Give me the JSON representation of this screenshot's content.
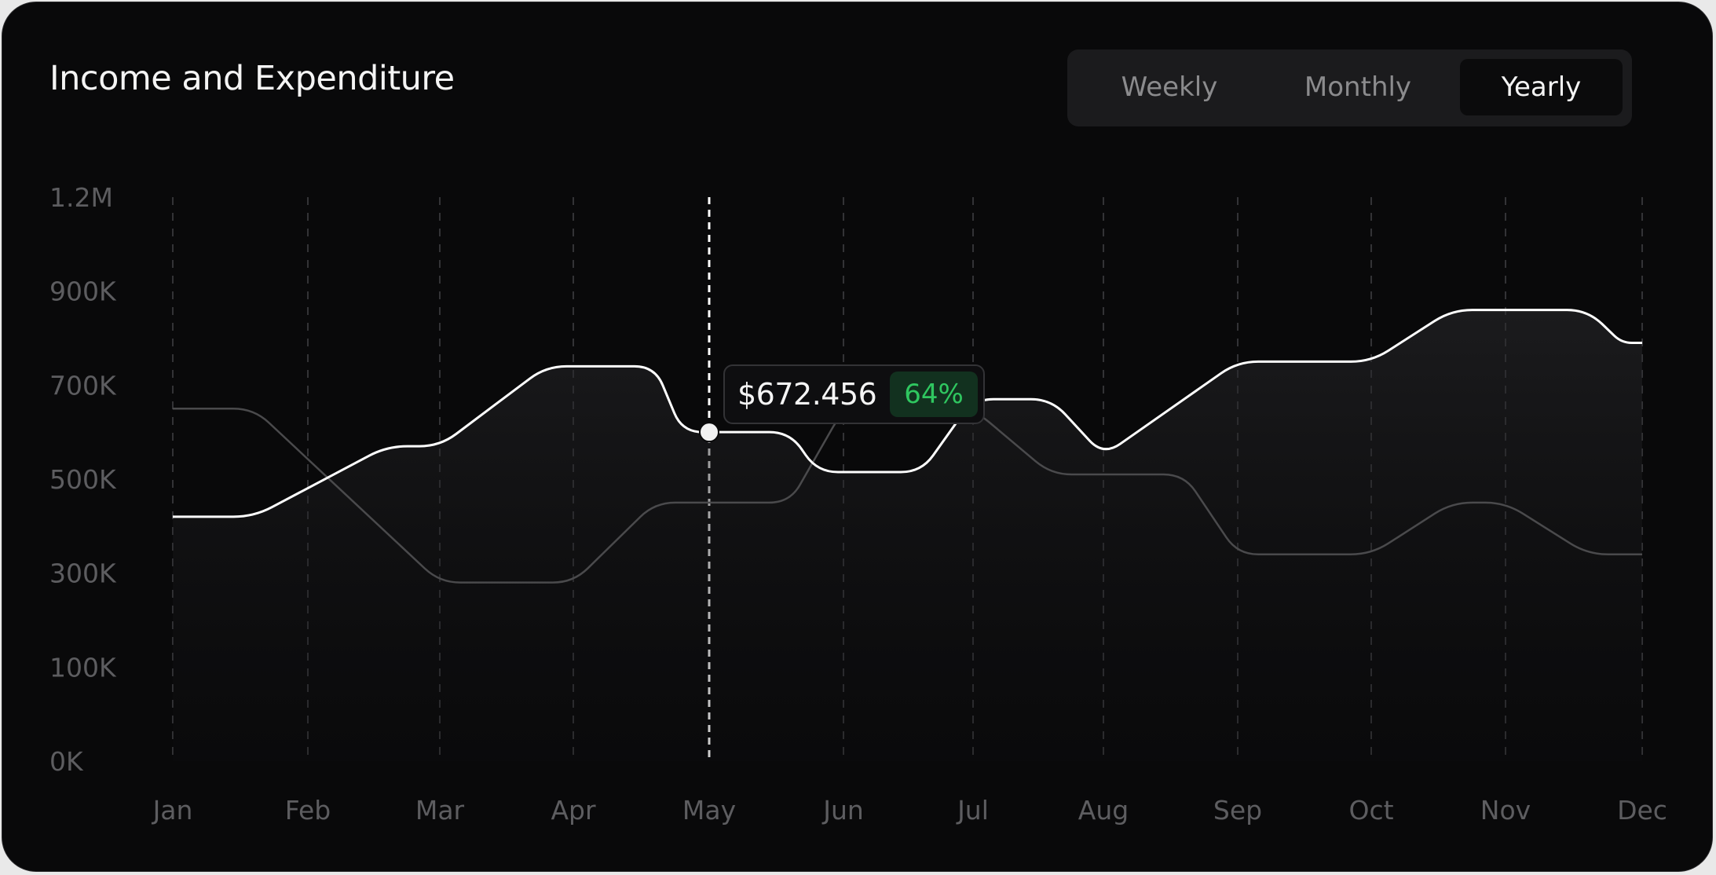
{
  "header": {
    "title": "Income and Expenditure"
  },
  "period_tabs": [
    {
      "label": "Weekly",
      "active": false
    },
    {
      "label": "Monthly",
      "active": false
    },
    {
      "label": "Yearly",
      "active": true
    }
  ],
  "tooltip": {
    "value": "$672.456",
    "badge": "64%",
    "badge_color": "#2fc760",
    "month": "May"
  },
  "colors": {
    "background": "#09090a",
    "primary_line": "#ffffff",
    "secondary_line": "#4a4a4c",
    "grid": "#333336",
    "axis_text": "#5d5d60"
  },
  "chart_data": {
    "type": "line",
    "title": "Income and Expenditure",
    "categories": [
      "Jan",
      "Feb",
      "Mar",
      "Apr",
      "May",
      "Jun",
      "Jul",
      "Aug",
      "Sep",
      "Oct",
      "Nov",
      "Dec"
    ],
    "y_tick_labels": [
      "0K",
      "100K",
      "300K",
      "500K",
      "700K",
      "900K",
      "1.2M"
    ],
    "y_tick_values": [
      0,
      200000,
      400000,
      600000,
      800000,
      1000000,
      1200000
    ],
    "ylim": [
      0,
      1200000
    ],
    "grid": "vertical dashed",
    "highlight_category": "May",
    "series": [
      {
        "style": "primary",
        "points": [
          [
            "Jan",
            520000
          ],
          [
            "Jan+",
            520000
          ],
          [
            "Feb+",
            670000
          ],
          [
            "Mar",
            670000
          ],
          [
            "Apr-",
            840000
          ],
          [
            "Apr+",
            840000
          ],
          [
            "May-",
            700000
          ],
          [
            "May+",
            700000
          ],
          [
            "Jun-",
            615000
          ],
          [
            "Jun+",
            615000
          ],
          [
            "Jul",
            770000
          ],
          [
            "Jul+",
            770000
          ],
          [
            "Aug",
            650000
          ],
          [
            "Sep",
            850000
          ],
          [
            "Oct",
            850000
          ],
          [
            "Oct+",
            960000
          ],
          [
            "Nov+",
            960000
          ],
          [
            "Nov++",
            890000
          ],
          [
            "Dec",
            890000
          ]
        ]
      },
      {
        "style": "secondary",
        "points": [
          [
            "Jan",
            750000
          ],
          [
            "Jan+",
            750000
          ],
          [
            "Mar",
            380000
          ],
          [
            "Apr",
            380000
          ],
          [
            "Apr+",
            550000
          ],
          [
            "May+",
            550000
          ],
          [
            "Jun",
            750000
          ],
          [
            "Jul",
            750000
          ],
          [
            "Jul+",
            610000
          ],
          [
            "Aug+",
            610000
          ],
          [
            "Sep",
            440000
          ],
          [
            "Oct",
            440000
          ],
          [
            "Oct+",
            550000
          ],
          [
            "Nov",
            550000
          ],
          [
            "Nov+",
            440000
          ],
          [
            "Dec",
            440000
          ]
        ]
      }
    ]
  }
}
